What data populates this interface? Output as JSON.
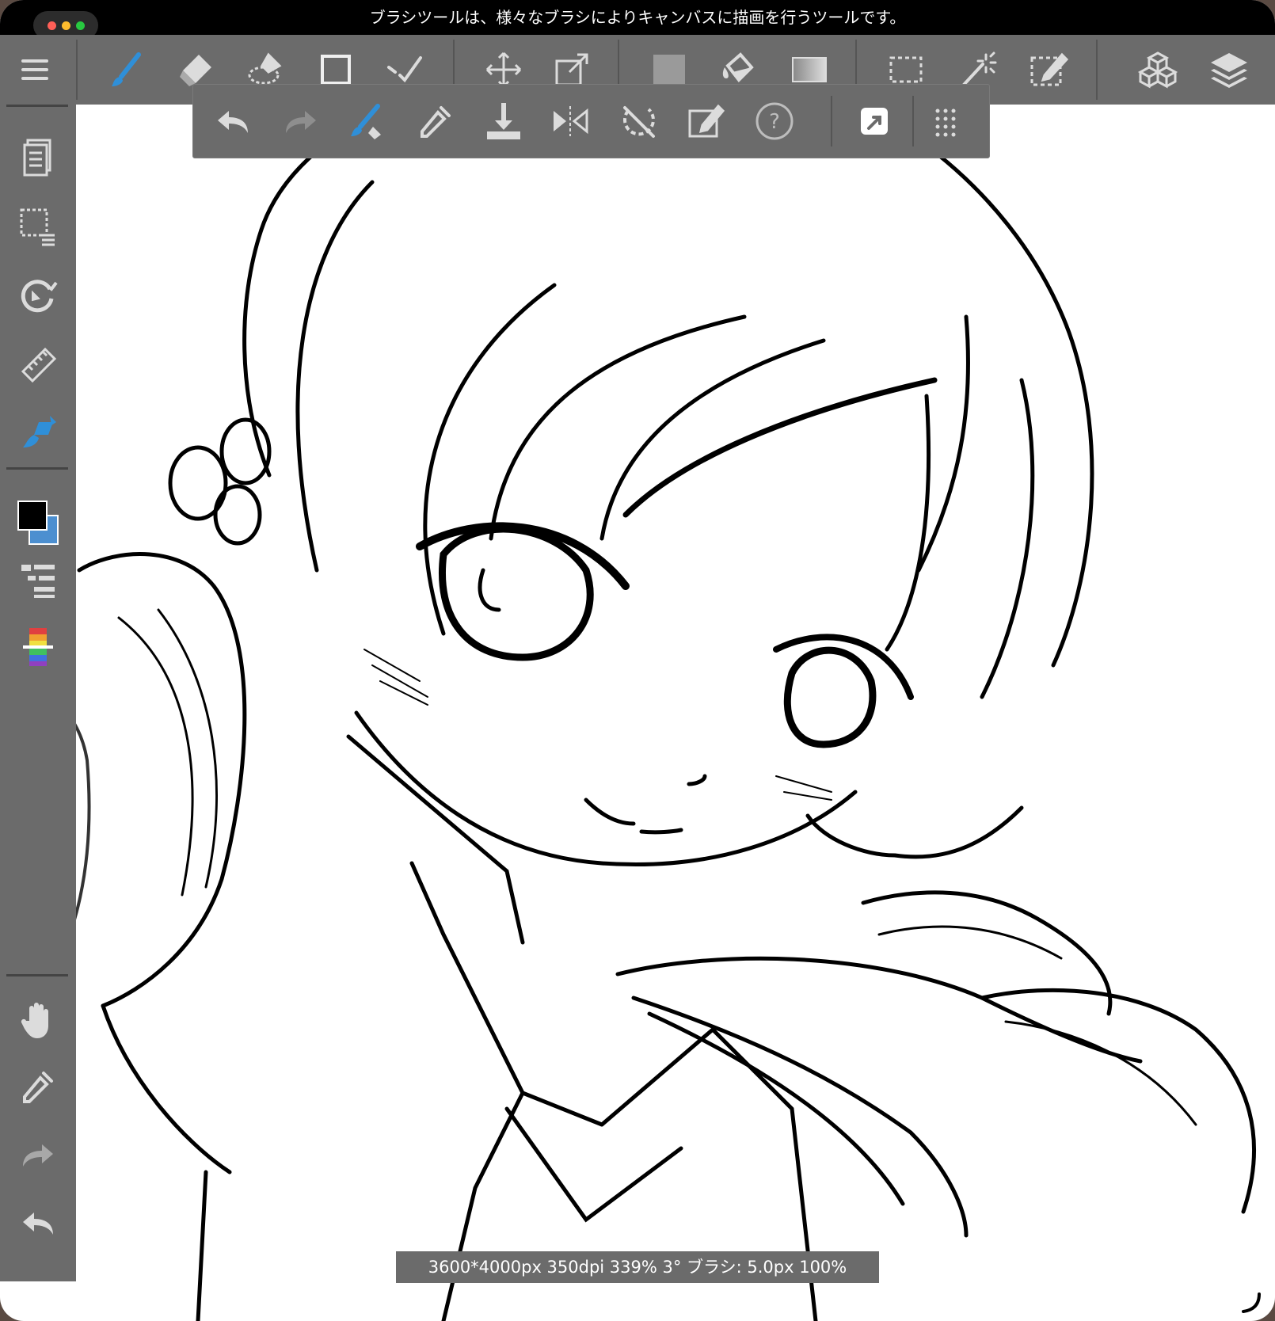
{
  "window": {
    "title": "ブラシツールは、様々なブラシによりキャンバスに描画を行うツールです。"
  },
  "top_toolbar": {
    "items": [
      {
        "name": "menu-icon"
      },
      {
        "name": "brush-icon",
        "active": true
      },
      {
        "name": "eraser-icon"
      },
      {
        "name": "smudge-icon"
      },
      {
        "name": "shape-rectangle-icon"
      },
      {
        "name": "line-icon"
      },
      {
        "name": "move-icon"
      },
      {
        "name": "transform-icon"
      },
      {
        "name": "fill-color-icon"
      },
      {
        "name": "bucket-icon"
      },
      {
        "name": "gradient-icon"
      },
      {
        "name": "select-rect-icon"
      },
      {
        "name": "magic-wand-icon"
      },
      {
        "name": "select-pen-icon"
      },
      {
        "name": "3d-material-icon"
      },
      {
        "name": "layers-icon"
      }
    ]
  },
  "sub_toolbar": {
    "items": [
      {
        "name": "undo-icon"
      },
      {
        "name": "redo-icon",
        "disabled": true
      },
      {
        "name": "brush-transform-icon"
      },
      {
        "name": "eyedropper-icon"
      },
      {
        "name": "save-download-icon"
      },
      {
        "name": "flip-horizontal-icon"
      },
      {
        "name": "rotate-reset-icon"
      },
      {
        "name": "edit-icon"
      },
      {
        "name": "help-icon"
      },
      {
        "name": "export-icon"
      },
      {
        "name": "grid-dots-icon"
      }
    ]
  },
  "sidebar": {
    "items": [
      {
        "name": "pages-icon"
      },
      {
        "name": "selection-list-icon"
      },
      {
        "name": "rotate-canvas-icon"
      },
      {
        "name": "ruler-icon"
      },
      {
        "name": "brush-settings-icon",
        "active": true
      },
      {
        "name": "color-swatch-icon"
      },
      {
        "name": "layer-list-icon"
      },
      {
        "name": "color-palette-icon"
      },
      {
        "name": "hand-icon"
      },
      {
        "name": "eyedropper-icon"
      },
      {
        "name": "redo-icon"
      },
      {
        "name": "undo-icon"
      }
    ],
    "foreground_color": "#000000",
    "background_color": "#4c8fd0"
  },
  "status_bar": {
    "text": "3600*4000px 350dpi 339% 3° ブラシ: 5.0px 100%"
  },
  "colors": {
    "toolbar_bg": "#6b6b6b",
    "accent": "#2f8fd8",
    "icon": "#dcdcdc"
  }
}
